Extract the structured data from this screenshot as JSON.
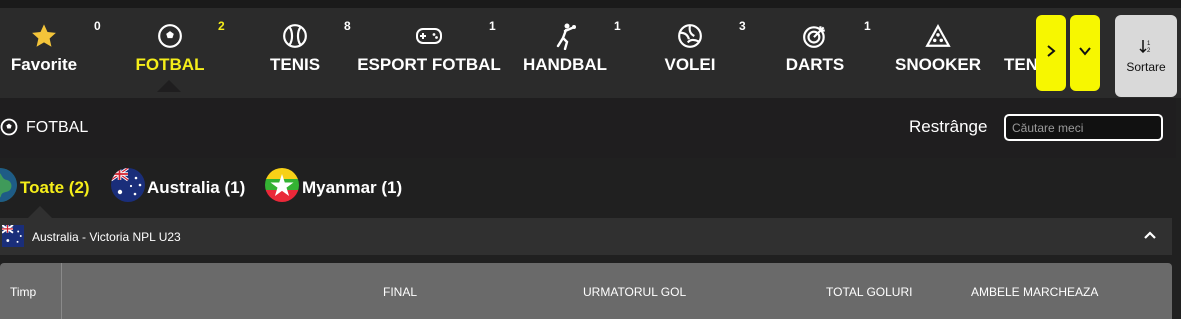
{
  "sports": [
    {
      "label": "Favorite",
      "count": "0",
      "icon": "star-icon"
    },
    {
      "label": "FOTBAL",
      "count": "2",
      "icon": "soccer-ball-icon",
      "active": true
    },
    {
      "label": "TENIS",
      "count": "8",
      "icon": "tennis-ball-icon"
    },
    {
      "label": "ESPORT FOTBAL",
      "count": "1",
      "icon": "gamepad-icon"
    },
    {
      "label": "HANDBAL",
      "count": "1",
      "icon": "handball-player-icon"
    },
    {
      "label": "VOLEI",
      "count": "3",
      "icon": "volleyball-icon"
    },
    {
      "label": "DARTS",
      "count": "1",
      "icon": "dartboard-icon"
    },
    {
      "label": "SNOOKER",
      "count": "",
      "icon": "snooker-triangle-icon"
    },
    {
      "label": "TEN",
      "count": "",
      "icon": ""
    }
  ],
  "nav": {
    "next_icon": "chevron-right-icon",
    "expand_icon": "chevron-down-icon"
  },
  "sort": {
    "label": "Sortare",
    "icon": "sort-icon"
  },
  "header": {
    "title": "FOTBAL",
    "restrict_label": "Restrânge",
    "search_placeholder": "Căutare meci"
  },
  "countries": [
    {
      "label": "Toate (2)",
      "active": true,
      "icon": "globe-icon"
    },
    {
      "label": "Australia  (1)",
      "icon": "australia-flag-icon"
    },
    {
      "label": "Myanmar  (1)",
      "icon": "myanmar-flag-icon"
    }
  ],
  "league": {
    "name": "Australia - Victoria NPL U23",
    "icon": "australia-flag-icon",
    "collapse_icon": "chevron-up-icon"
  },
  "table": {
    "columns": [
      "Timp",
      "FINAL",
      "URMATORUL GOL",
      "TOTAL GOLURI",
      "AMBELE MARCHEAZA"
    ]
  },
  "colors": {
    "accent": "#f5ee1a",
    "nav_button": "#f7f700",
    "bar_bg": "#2b2b2b",
    "table_head": "#6a6a6a"
  }
}
